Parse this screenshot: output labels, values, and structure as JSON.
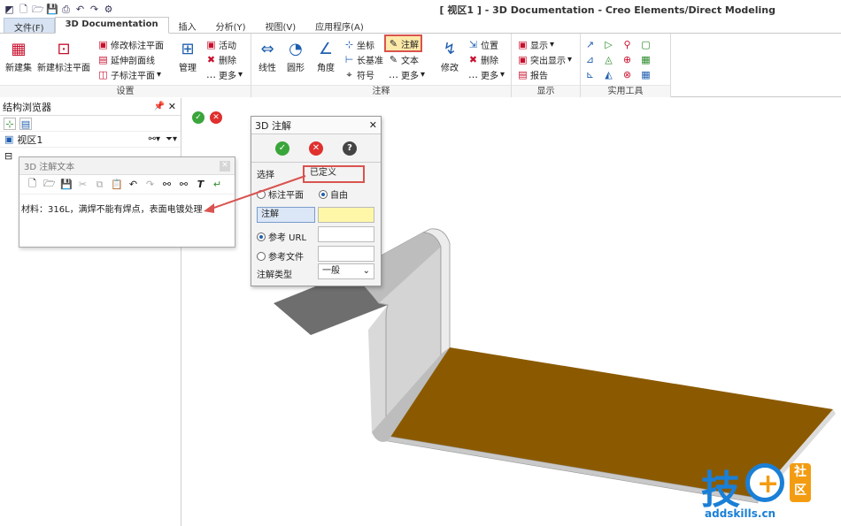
{
  "window": {
    "title": "[ 视区1 ] - 3D Documentation - Creo Elements/Direct Modeling"
  },
  "tabs": [
    {
      "label": "文件(F)"
    },
    {
      "label": "3D Documentation"
    },
    {
      "label": "插入"
    },
    {
      "label": "分析(Y)"
    },
    {
      "label": "视图(V)"
    },
    {
      "label": "应用程序(A)"
    }
  ],
  "ribbon": {
    "setup": {
      "label": "设置",
      "new_set": "新建集",
      "new_plane": "新建标注平面",
      "modify_plane": "修改标注平面",
      "extend_section": "延伸剖面线",
      "sub_plane": "子标注平面",
      "manage": "管理",
      "activate": "活动",
      "delete": "删除",
      "more": "更多"
    },
    "annotation": {
      "label": "注释",
      "linear": "线性",
      "radial": "圆形",
      "angle": "角度",
      "coord": "坐标",
      "chain": "长基准",
      "symbol": "符号",
      "note": "注解",
      "text": "文本",
      "more": "更多",
      "modify": "修改",
      "position": "位置",
      "delete": "删除",
      "more2": "更多"
    },
    "display": {
      "label": "显示",
      "show": "显示",
      "highlight": "突出显示",
      "report": "报告"
    },
    "utilities": {
      "label": "实用工具"
    }
  },
  "browser": {
    "title": "结构浏览器",
    "viewport": "视区1"
  },
  "text_dialog": {
    "title": "3D 注解文本",
    "content": "材料：316L，满焊不能有焊点，表面电镀处理"
  },
  "annotation_dialog": {
    "title": "3D 注解",
    "select_label": "选择",
    "select_value": "已定义",
    "opt_plane": "标注平面",
    "opt_free": "自由",
    "note_label": "注解",
    "ref_url": "参考 URL",
    "ref_file": "参考文件",
    "type_label": "注解类型",
    "type_value": "一般"
  },
  "watermark": {
    "brand": "技",
    "plus": "+",
    "community_top": "社",
    "community_bottom": "区",
    "url": "addskills.cn"
  },
  "colors": {
    "plate_top": "#8b5a00",
    "accent_red": "#d9534f",
    "ok_green": "#3aa53a",
    "cancel_red": "#e0302e",
    "note_field": "#fff7a8"
  }
}
